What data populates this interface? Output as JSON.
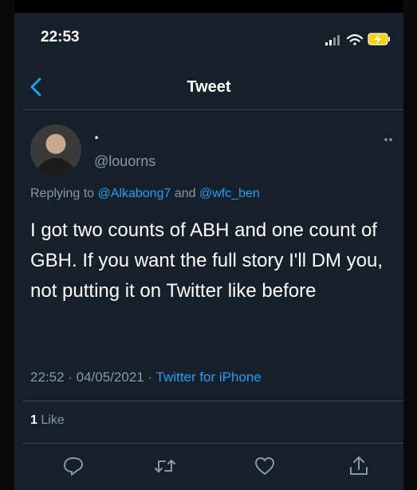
{
  "status_bar": {
    "time": "22:53"
  },
  "nav": {
    "title": "Tweet",
    "back_icon": "chevron-left-icon"
  },
  "tweet": {
    "display_name": "·",
    "handle": "@louorns",
    "replying_prefix": "Replying to",
    "mention_1": "@Alkabong7",
    "replying_and": "and",
    "mention_2": "@wfc_ben",
    "text": "I got two counts of ABH and one count of GBH. If you want the full story I'll DM you, not putting it on Twitter like before",
    "timestamp": "22:52 · 04/05/2021 ·",
    "source": "Twitter for iPhone",
    "like_count": "1",
    "like_label": "Like"
  },
  "colors": {
    "background": "#15202b",
    "accent": "#1da1f2",
    "muted": "#8899a6",
    "divider": "#38444d"
  },
  "actions": [
    "reply-icon",
    "retweet-icon",
    "like-icon",
    "share-icon"
  ]
}
